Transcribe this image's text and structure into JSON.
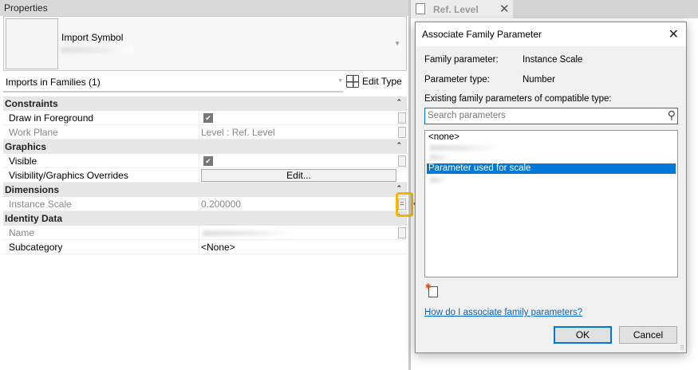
{
  "properties": {
    "title": "Properties",
    "type_name": "Import Symbol",
    "filter": "Imports in Families (1)",
    "edit_type": "Edit Type",
    "sections": {
      "constraints": "Constraints",
      "graphics": "Graphics",
      "dimensions": "Dimensions",
      "identity": "Identity Data"
    },
    "rows": {
      "draw_fg": {
        "label": "Draw in Foreground",
        "checked": true
      },
      "work_plane": {
        "label": "Work Plane",
        "value": "Level : Ref. Level"
      },
      "visible": {
        "label": "Visible",
        "checked": true
      },
      "vg": {
        "label": "Visibility/Graphics Overrides",
        "value": "Edit..."
      },
      "instance_scale": {
        "label": "Instance Scale",
        "value": "0.200000"
      },
      "name": {
        "label": "Name"
      },
      "subcategory": {
        "label": "Subcategory",
        "value": "<None>"
      }
    }
  },
  "view_tab": {
    "label": "Ref. Level"
  },
  "dialog": {
    "title": "Associate Family Parameter",
    "family_param_label": "Family parameter:",
    "family_param_value": "Instance Scale",
    "param_type_label": "Parameter type:",
    "param_type_value": "Number",
    "existing_label": "Existing family parameters of compatible type:",
    "search_placeholder": "Search parameters",
    "list": {
      "none": "<none>",
      "selected": "Parameter used for scale"
    },
    "help_link": "How do I associate family parameters?",
    "ok": "OK",
    "cancel": "Cancel"
  },
  "colors": {
    "accent": "#0078d7",
    "highlight": "#f5b800",
    "arrow": "#e81010"
  }
}
